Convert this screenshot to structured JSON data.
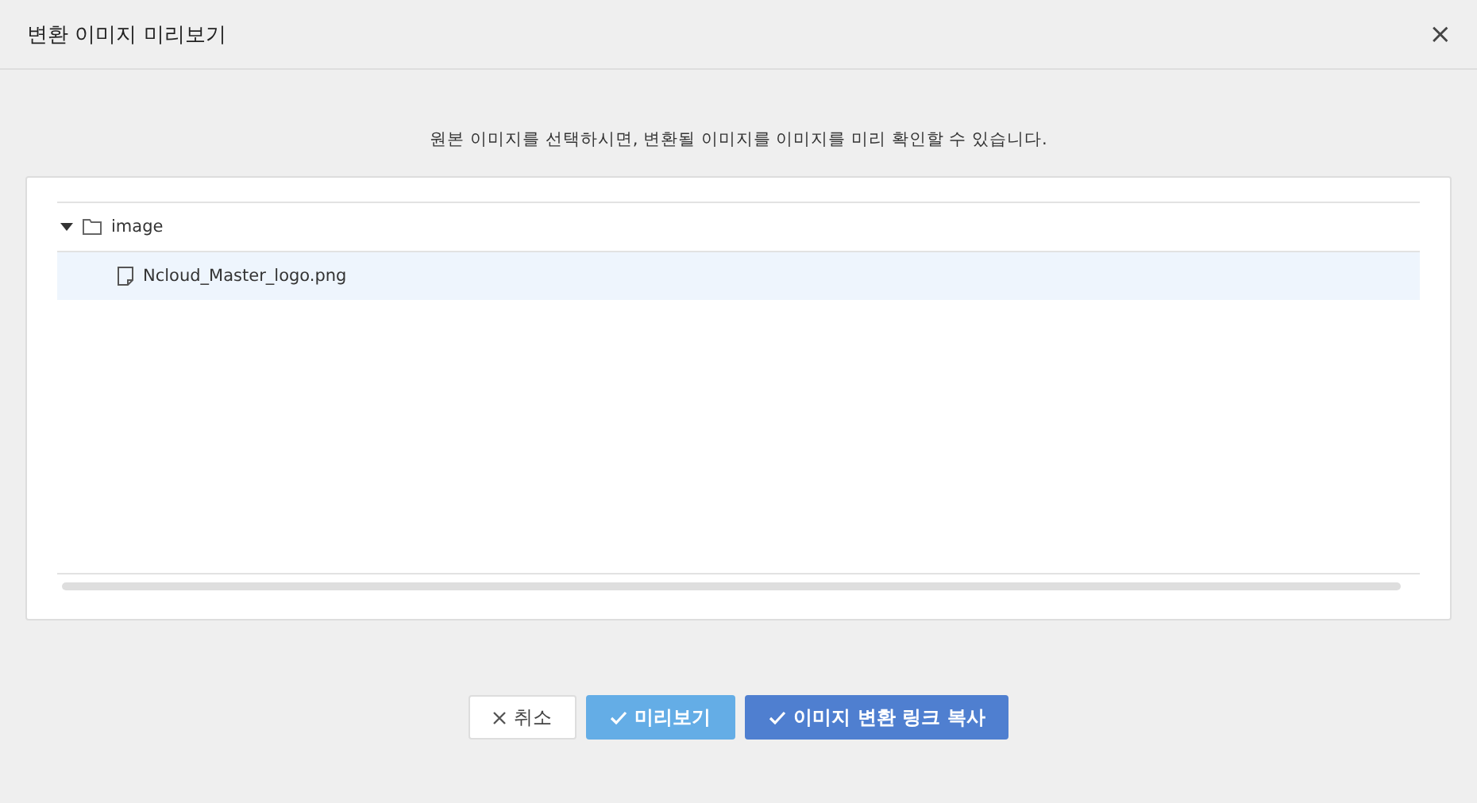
{
  "dialog": {
    "title": "변환 이미지 미리보기",
    "close": "×"
  },
  "instruction": "원본 이미지를 선택하시면, 변환될 이미지를 이미지를 미리 확인할 수 있습니다.",
  "tree": [
    {
      "label": "image",
      "kind": "folder",
      "expanded": true,
      "selected": false,
      "children": [
        {
          "label": "Ncloud_Master_logo.png",
          "kind": "file",
          "selected": true
        }
      ]
    }
  ],
  "buttons": [
    {
      "label": "취소",
      "kind": "cancel"
    },
    {
      "label": "미리보기",
      "kind": "preview"
    },
    {
      "label": "이미지 변환 링크 복사",
      "kind": "primary"
    }
  ]
}
